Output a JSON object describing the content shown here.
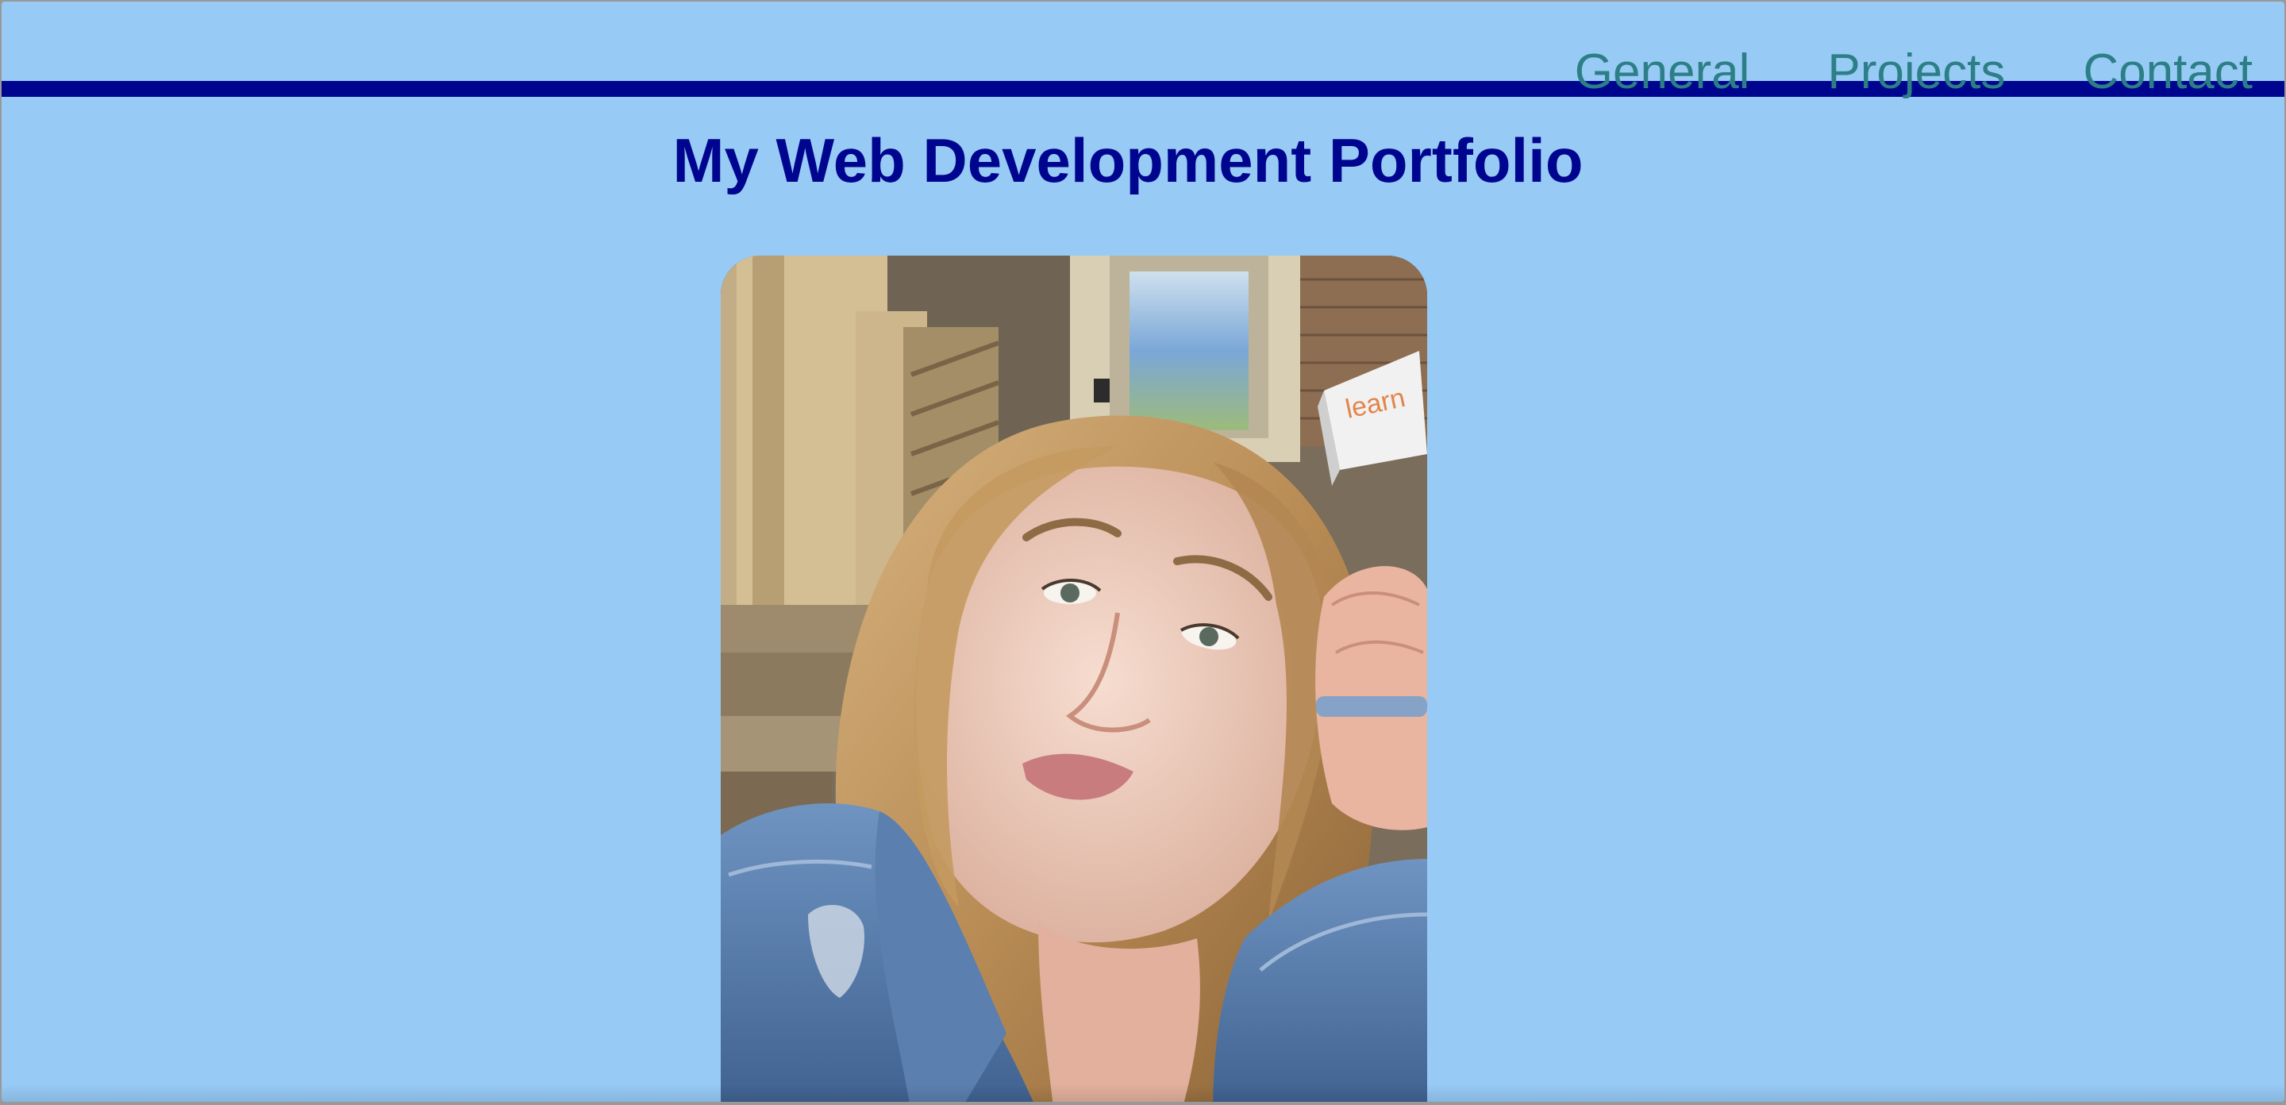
{
  "nav": {
    "items": [
      {
        "label": "General"
      },
      {
        "label": "Projects"
      },
      {
        "label": "Contact"
      }
    ]
  },
  "header": {
    "title": "My Web Development Portfolio"
  },
  "photo": {
    "box_text": "learn"
  },
  "colors": {
    "background": "#97caf5",
    "rule": "#00058f",
    "title": "#00058f",
    "nav_link": "#2c7f86"
  }
}
